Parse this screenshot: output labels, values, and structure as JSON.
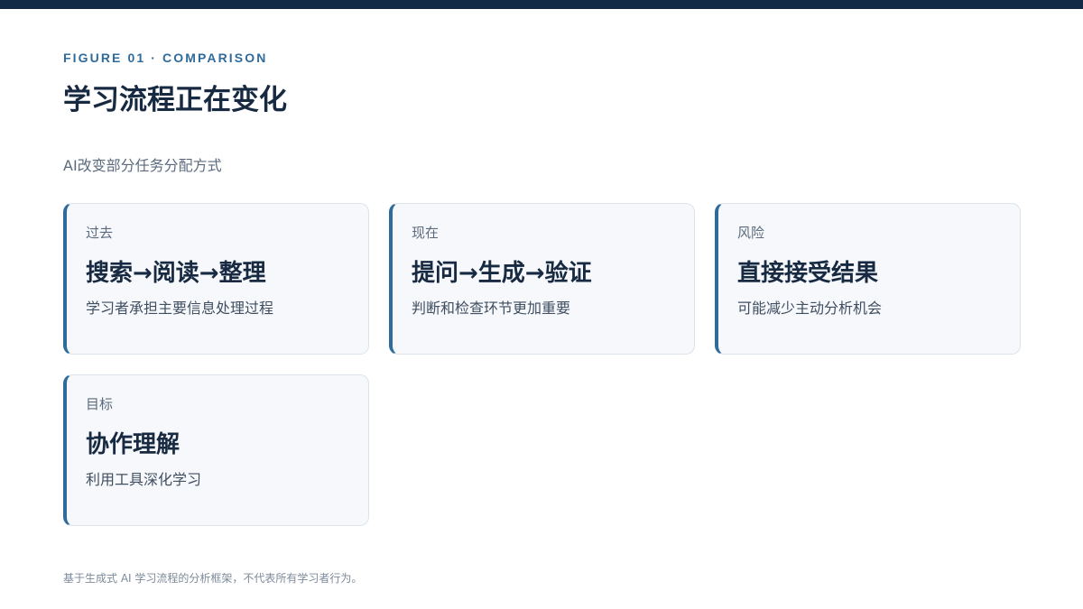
{
  "header": {
    "eyebrow": "FIGURE 01 · COMPARISON",
    "title": "学习流程正在变化",
    "subtitle": "AI改变部分任务分配方式"
  },
  "cards": [
    {
      "label": "过去",
      "heading": "搜索→阅读→整理",
      "description": "学习者承担主要信息处理过程"
    },
    {
      "label": "现在",
      "heading": "提问→生成→验证",
      "description": "判断和检查环节更加重要"
    },
    {
      "label": "风险",
      "heading": "直接接受结果",
      "description": "可能减少主动分析机会"
    },
    {
      "label": "目标",
      "heading": "协作理解",
      "description": "利用工具深化学习"
    }
  ],
  "footnote": "基于生成式 AI 学习流程的分析框架，不代表所有学习者行为。",
  "colors": {
    "top_bar": "#122a45",
    "accent": "#2f6b9b",
    "heading_text": "#172a42",
    "card_background": "#f6f8fb"
  }
}
